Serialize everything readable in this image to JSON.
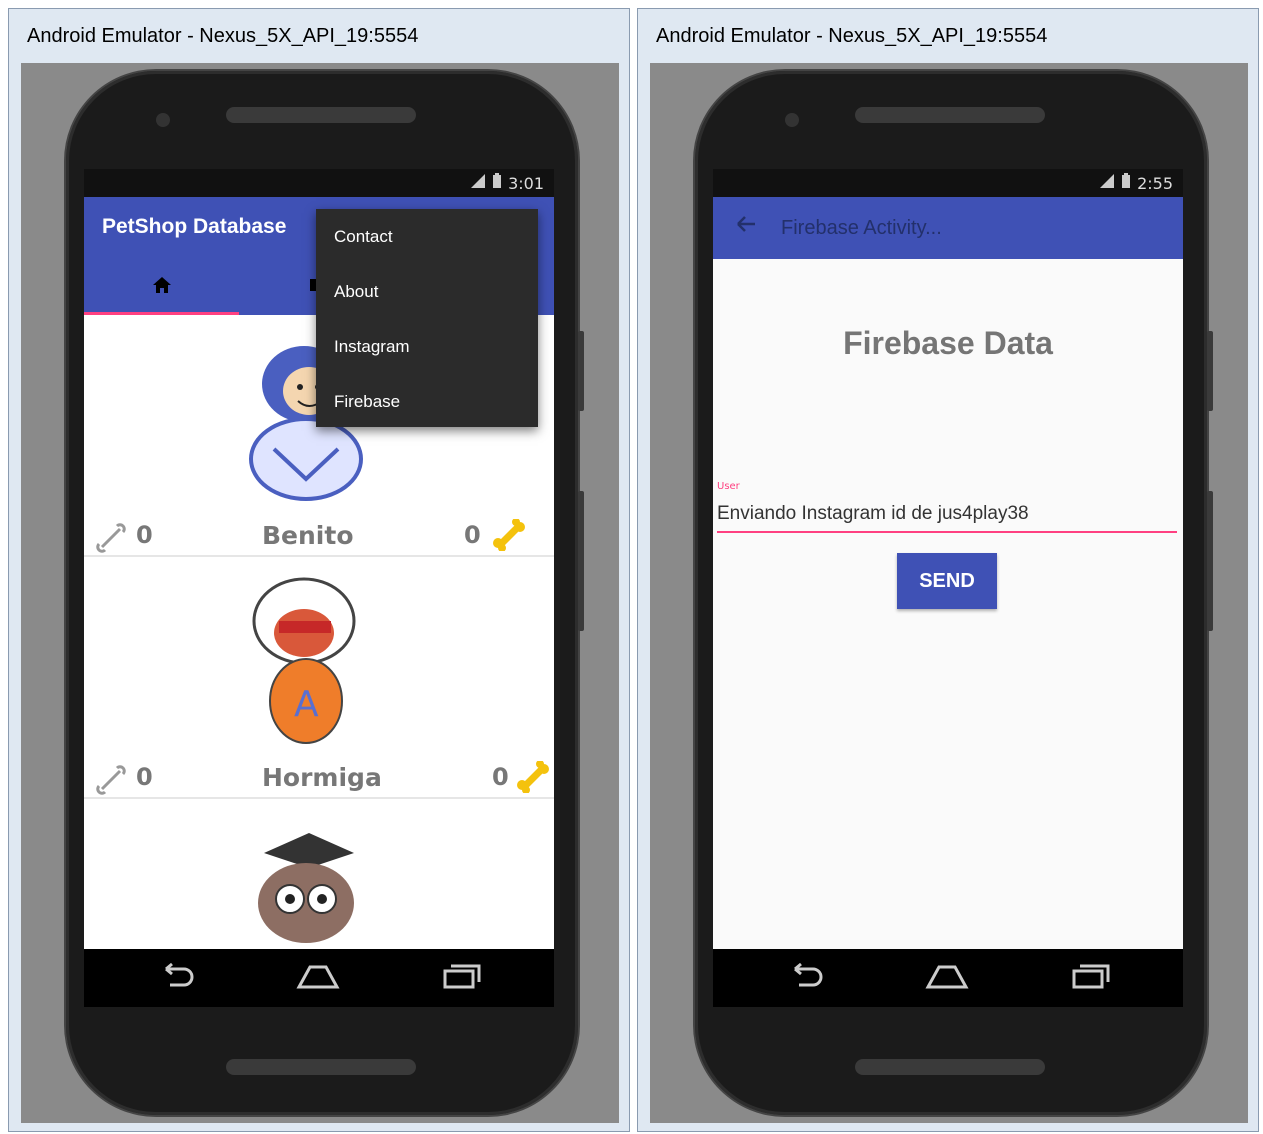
{
  "left_window": {
    "title": "Android Emulator - Nexus_5X_API_19:5554",
    "status_time": "3:01",
    "app_title": "PetShop Database",
    "menu_items": [
      "Contact",
      "About",
      "Instagram",
      "Firebase"
    ],
    "pets": [
      {
        "name": "Benito",
        "likes_left": "0",
        "likes_right": "0"
      },
      {
        "name": "Hormiga",
        "likes_left": "0",
        "likes_right": "0"
      },
      {
        "name": "",
        "likes_left": "",
        "likes_right": ""
      }
    ],
    "colors": {
      "primary": "#3f51b5",
      "accent": "#ff4081",
      "bone": "#f4c20d"
    }
  },
  "right_window": {
    "title": "Android Emulator - Nexus_5X_API_19:5554",
    "status_time": "2:55",
    "toolbar_title": "Firebase Activity...",
    "heading": "Firebase Data",
    "field_label": "User",
    "field_value": "Enviando Instagram id de jus4play38",
    "send_label": "SEND"
  }
}
